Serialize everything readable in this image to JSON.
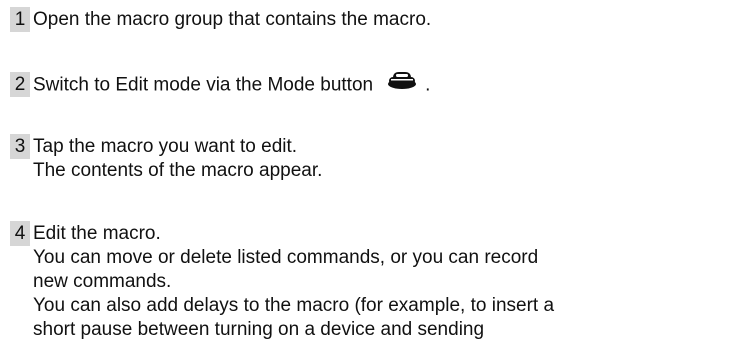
{
  "steps": [
    {
      "number": "1",
      "lines": [
        "Open the macro group that contains the macro."
      ]
    },
    {
      "number": "2",
      "text_before_icon": "Switch to Edit mode via the Mode button",
      "icon": "mode-button-icon",
      "text_after_icon": "."
    },
    {
      "number": "3",
      "lines": [
        "Tap the macro you want to edit.",
        "The contents of the macro appear."
      ]
    },
    {
      "number": "4",
      "lines": [
        "Edit the macro.",
        "You can move or delete listed commands, or you can record",
        "new commands.",
        "You can also add delays to the macro (for example, to insert a",
        "short pause between turning on a device and sending"
      ]
    }
  ]
}
